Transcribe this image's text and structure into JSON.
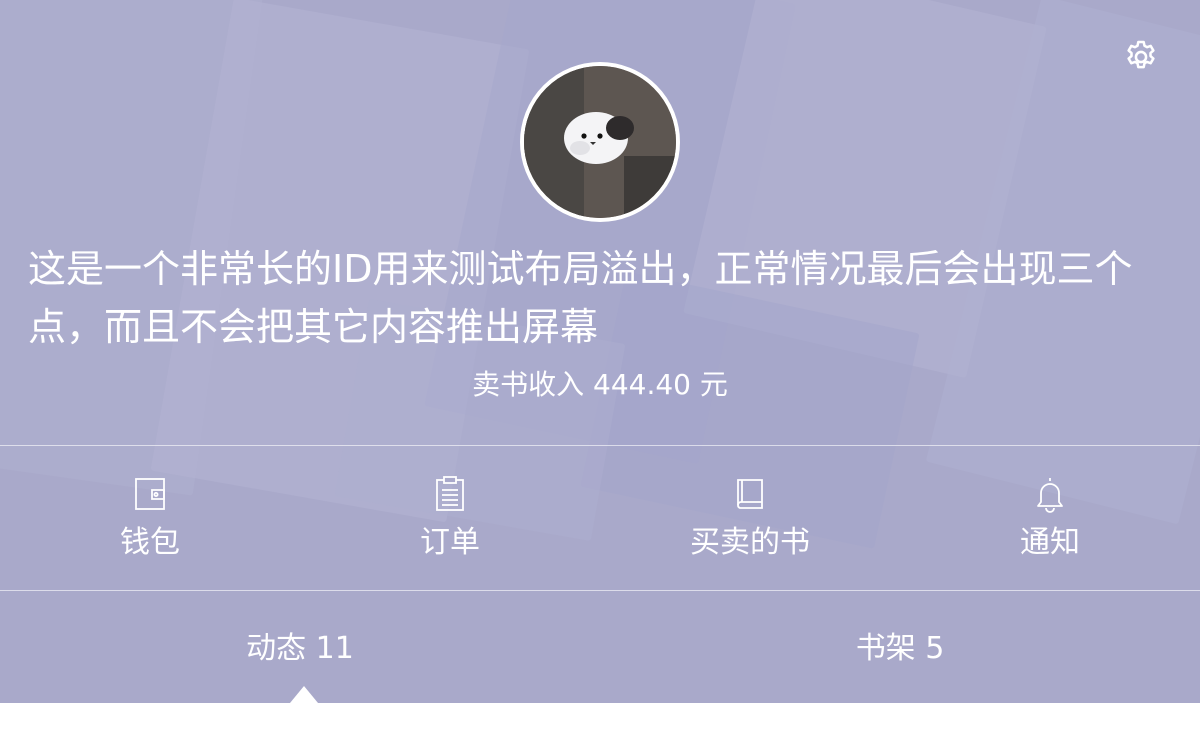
{
  "profile": {
    "nickname": "这是一个非常长的ID用来测试布局溢出，正常情况最后会出现三个点，而且不会把其它内容推出屏幕",
    "income": "卖书收入 444.40 元"
  },
  "actions": [
    {
      "label": "钱包",
      "icon": "wallet-icon"
    },
    {
      "label": "订单",
      "icon": "clipboard-icon"
    },
    {
      "label": "买卖的书",
      "icon": "book-icon"
    },
    {
      "label": "通知",
      "icon": "bell-icon"
    }
  ],
  "tabs": [
    {
      "label": "动态 11",
      "active": true
    },
    {
      "label": "书架 5",
      "active": false
    }
  ],
  "colors": {
    "header_bg": "#a9a9cb",
    "text": "#ffffff"
  }
}
